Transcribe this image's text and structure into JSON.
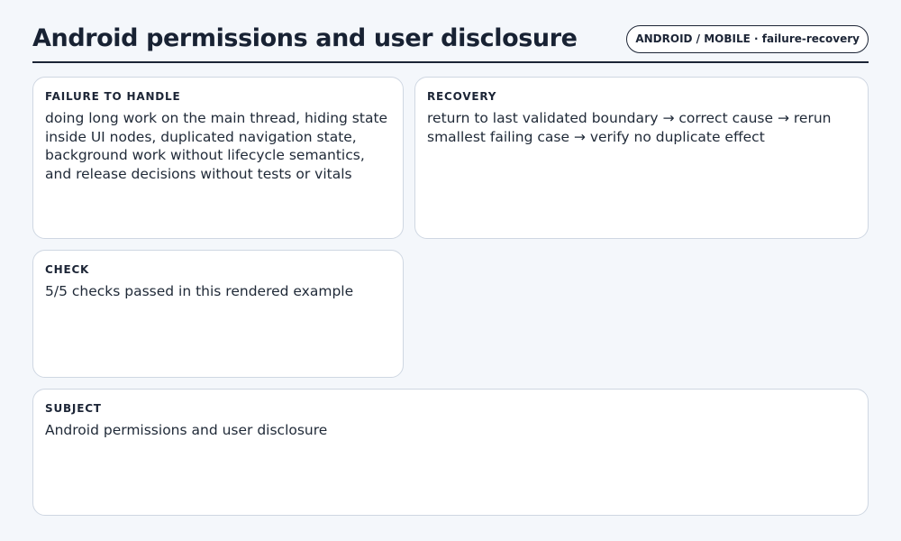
{
  "header": {
    "title": "Android permissions and user disclosure",
    "badge": "ANDROID / MOBILE · failure-recovery"
  },
  "cards": {
    "failure": {
      "label": "FAILURE TO HANDLE",
      "body": "doing long work on the main thread, hiding state inside UI nodes, duplicated navigation state, background work without lifecycle semantics, and release decisions without tests or vitals"
    },
    "recovery": {
      "label": "RECOVERY",
      "body": "return to last validated boundary → correct cause → rerun smallest failing case → verify no duplicate effect"
    },
    "check": {
      "label": "CHECK",
      "body": "5/5 checks passed in this rendered example"
    },
    "subject": {
      "label": "SUBJECT",
      "body": "Android permissions and user disclosure"
    }
  }
}
